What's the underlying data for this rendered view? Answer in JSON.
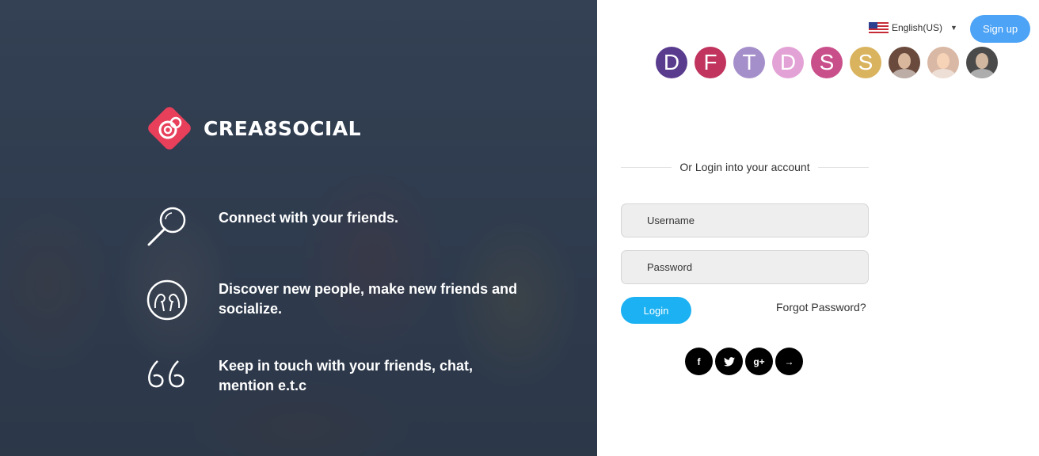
{
  "brand": {
    "name": "CREA8SOCIAL",
    "accent": "#e83f5b"
  },
  "features": [
    {
      "icon": "search-icon",
      "text": "Connect with your friends."
    },
    {
      "icon": "people-icon",
      "text": "Discover new people, make new friends and socialize."
    },
    {
      "icon": "quote-icon",
      "text": "Keep in touch with your friends, chat, mention e.t.c"
    }
  ],
  "header": {
    "language": {
      "label": "English(US)",
      "flag": "us-flag-icon"
    },
    "signup_label": "Sign up"
  },
  "avatars": [
    {
      "letter": "D",
      "color": "#5a3c8f"
    },
    {
      "letter": "F",
      "color": "#c0345e"
    },
    {
      "letter": "T",
      "color": "#a58fca"
    },
    {
      "letter": "D",
      "color": "#e3a2d5"
    },
    {
      "letter": "S",
      "color": "#c94f8b"
    },
    {
      "letter": "S",
      "color": "#d9b35e"
    },
    {
      "letter": "",
      "color": "#6a4a3c",
      "photo": true
    },
    {
      "letter": "",
      "color": "#d9b8a5",
      "photo": true
    },
    {
      "letter": "",
      "color": "#4a4a4a",
      "photo": true
    }
  ],
  "login": {
    "divider_text": "Or Login into your account",
    "username_placeholder": "Username",
    "password_placeholder": "Password",
    "login_label": "Login",
    "forgot_label": "Forgot Password?"
  },
  "socials": [
    {
      "name": "facebook-icon",
      "glyph": "f"
    },
    {
      "name": "twitter-icon",
      "glyph": ""
    },
    {
      "name": "google-plus-icon",
      "glyph": "g+"
    },
    {
      "name": "arrow-right-icon",
      "glyph": "→"
    }
  ]
}
